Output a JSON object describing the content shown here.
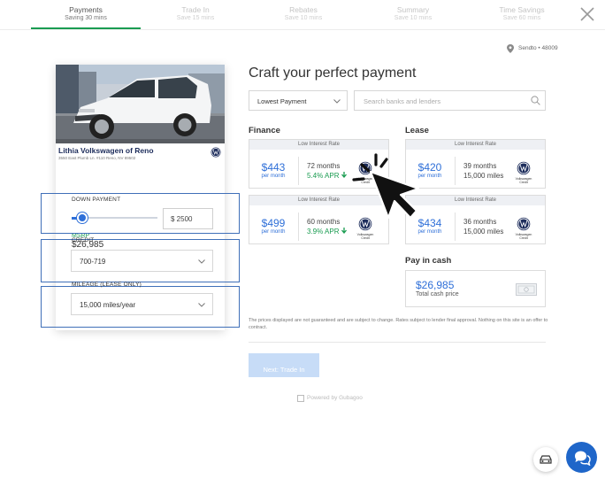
{
  "steps": [
    {
      "title": "Payments",
      "subtitle": "Saving 30 mins"
    },
    {
      "title": "Trade In",
      "subtitle": "Save 15 mins"
    },
    {
      "title": "Rebates",
      "subtitle": "Save 10 mins"
    },
    {
      "title": "Summary",
      "subtitle": "Save 10 mins"
    },
    {
      "title": "Time Savings",
      "subtitle": "Save 60 mins"
    }
  ],
  "location": "Sendto • 48009",
  "vehicle": {
    "dealer_name": "Lithia Volkswagen of Reno",
    "dealer_address": "3550 East Plumb Ln. #110 Reno, NV 89502",
    "msrp_label": "MSRP",
    "msrp_value": "$26,985"
  },
  "down_payment": {
    "label": "DOWN PAYMENT",
    "value": "$ 2500",
    "slider_fraction": 0.12
  },
  "credit": {
    "label": "CREDIT",
    "value": "700-719"
  },
  "mileage": {
    "label": "MILEAGE (LEASE ONLY)",
    "value": "15,000 miles/year"
  },
  "main_title": "Craft your perfect payment",
  "sort": {
    "value": "Lowest Payment"
  },
  "search": {
    "placeholder": "Search banks and lenders"
  },
  "finance": {
    "heading": "Finance",
    "offers": [
      {
        "band": "Low Interest Rate",
        "price": "$443",
        "per": "per month",
        "term": "72 months",
        "apr": "5.4% APR",
        "lender": "Volkswagen Credit"
      },
      {
        "band": "Low Interest Rate",
        "price": "$499",
        "per": "per month",
        "term": "60 months",
        "apr": "3.9% APR",
        "lender": "Volkswagen Credit"
      }
    ]
  },
  "lease": {
    "heading": "Lease",
    "offers": [
      {
        "band": "Low Interest Rate",
        "price": "$420",
        "per": "per month",
        "term": "39 months",
        "miles": "15,000 miles",
        "lender": "Volkswagen Credit"
      },
      {
        "band": "Low Interest Rate",
        "price": "$434",
        "per": "per month",
        "term": "36 months",
        "miles": "15,000 miles",
        "lender": "Volkswagen Credit"
      }
    ]
  },
  "cash": {
    "heading": "Pay in cash",
    "price": "$26,985",
    "label": "Total cash price"
  },
  "disclaimer": "The prices displayed are not guaranteed and are subject to change. Rates subject to lender final approval. Nothing on this site is an offer to contract.",
  "next_button": "Next: Trade In",
  "powered_by": "Powered by Gubagoo",
  "colors": {
    "accent": "#2e6fd8",
    "green": "#1a9c51",
    "highlight": "#3f6fb8",
    "chat": "#1f66c9"
  }
}
